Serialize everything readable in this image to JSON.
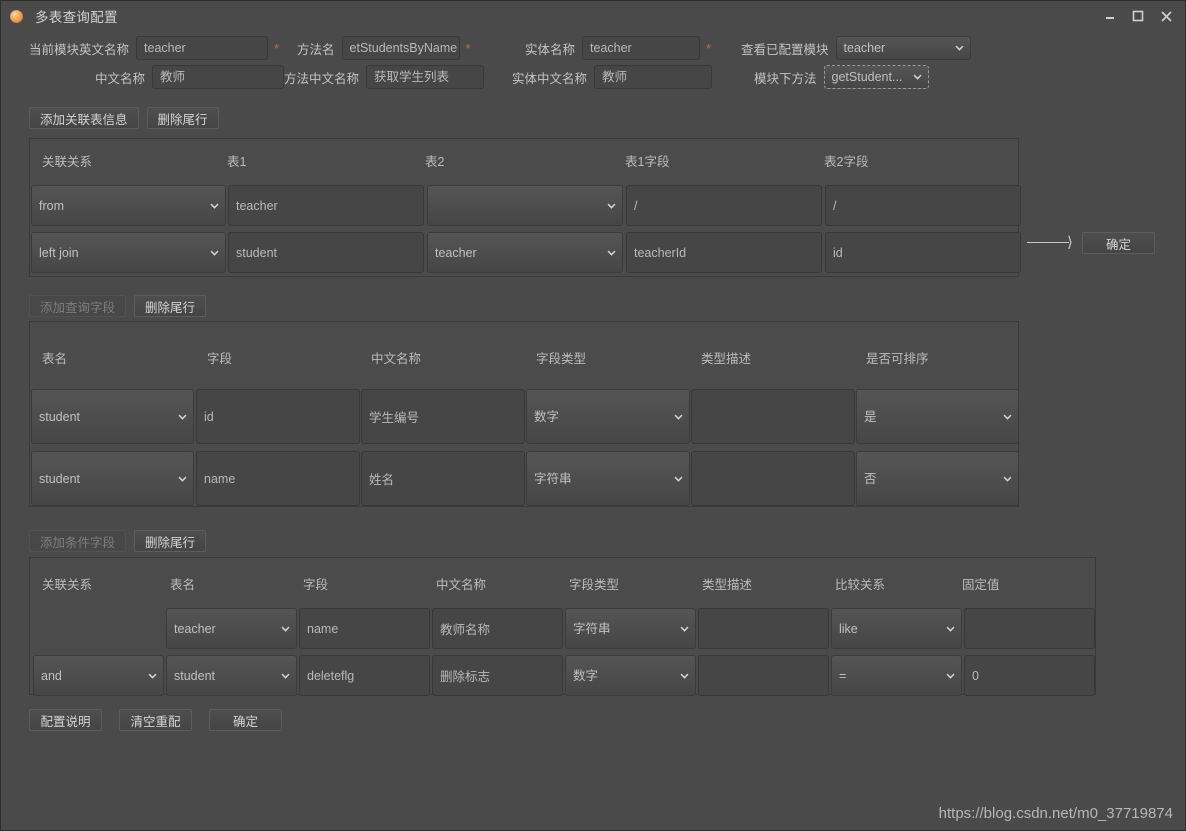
{
  "window": {
    "title": "多表查询配置",
    "icon": "app-palette-icon",
    "controls": {
      "minimize": "minimize-icon",
      "maximize": "maximize-icon",
      "close": "close-icon"
    }
  },
  "header": {
    "fields": [
      {
        "label": "当前模块英文名称",
        "value": "teacher",
        "type": "text",
        "required": true
      },
      {
        "label": "方法名",
        "value": "etStudentsByName",
        "type": "text",
        "required": true
      },
      {
        "label": "实体名称",
        "value": "teacher",
        "type": "text",
        "required": true
      },
      {
        "label": "查看已配置模块",
        "value": "teacher",
        "type": "select",
        "required": false
      },
      {
        "label": "中文名称",
        "value": "教师",
        "type": "text",
        "required": false
      },
      {
        "label": "方法中文名称",
        "value": "获取学生列表",
        "type": "text",
        "required": false
      },
      {
        "label": "实体中文名称",
        "value": "教师",
        "type": "text",
        "required": false
      },
      {
        "label": "模块下方法",
        "value": "getStudent...",
        "type": "select",
        "required": false
      }
    ]
  },
  "section_relation": {
    "buttons": [
      {
        "label": "添加关联表信息",
        "disabled": false
      },
      {
        "label": "删除尾行",
        "disabled": false
      }
    ],
    "columns": [
      "关联关系",
      "表1",
      "表2",
      "表1字段",
      "表2字段"
    ],
    "rows": [
      {
        "relation": {
          "value": "from",
          "type": "select"
        },
        "table1": {
          "value": "teacher",
          "type": "text"
        },
        "table2": {
          "value": "",
          "type": "select"
        },
        "field1": {
          "value": "/",
          "type": "text"
        },
        "field2": {
          "value": "/",
          "type": "text"
        }
      },
      {
        "relation": {
          "value": "left join",
          "type": "select"
        },
        "table1": {
          "value": "student",
          "type": "text"
        },
        "table2": {
          "value": "teacher",
          "type": "select"
        },
        "field1": {
          "value": "teacherId",
          "type": "text"
        },
        "field2": {
          "value": "id",
          "type": "text"
        }
      }
    ],
    "confirm_label": "确定",
    "arrow": "arrow-right-icon"
  },
  "section_query": {
    "buttons": [
      {
        "label": "添加查询字段",
        "disabled": true
      },
      {
        "label": "删除尾行",
        "disabled": false
      }
    ],
    "columns": [
      "表名",
      "字段",
      "中文名称",
      "字段类型",
      "类型描述",
      "是否可排序"
    ],
    "rows": [
      {
        "table": {
          "value": "student",
          "type": "select"
        },
        "field": {
          "value": "id",
          "type": "text"
        },
        "cn_name": {
          "value": "学生编号",
          "type": "text"
        },
        "field_type": {
          "value": "数字",
          "type": "select"
        },
        "type_desc": {
          "value": "",
          "type": "text"
        },
        "sortable": {
          "value": "是",
          "type": "select"
        }
      },
      {
        "table": {
          "value": "student",
          "type": "select"
        },
        "field": {
          "value": "name",
          "type": "text"
        },
        "cn_name": {
          "value": "姓名",
          "type": "text"
        },
        "field_type": {
          "value": "字符串",
          "type": "select"
        },
        "type_desc": {
          "value": "",
          "type": "text"
        },
        "sortable": {
          "value": "否",
          "type": "select"
        }
      }
    ]
  },
  "section_condition": {
    "buttons": [
      {
        "label": "添加条件字段",
        "disabled": true
      },
      {
        "label": "删除尾行",
        "disabled": false
      }
    ],
    "columns": [
      "关联关系",
      "表名",
      "字段",
      "中文名称",
      "字段类型",
      "类型描述",
      "比较关系",
      "固定值"
    ],
    "rows": [
      {
        "relation": {
          "value": "",
          "type": "none"
        },
        "table": {
          "value": "teacher",
          "type": "select"
        },
        "field": {
          "value": "name",
          "type": "text"
        },
        "cn_name": {
          "value": "教师名称",
          "type": "text"
        },
        "field_type": {
          "value": "字符串",
          "type": "select"
        },
        "type_desc": {
          "value": "",
          "type": "text"
        },
        "compare": {
          "value": "like",
          "type": "select"
        },
        "fixed_value": {
          "value": "",
          "type": "text"
        }
      },
      {
        "relation": {
          "value": "and",
          "type": "select"
        },
        "table": {
          "value": "student",
          "type": "select"
        },
        "field": {
          "value": "deleteflg",
          "type": "text"
        },
        "cn_name": {
          "value": "删除标志",
          "type": "text"
        },
        "field_type": {
          "value": "数字",
          "type": "select"
        },
        "type_desc": {
          "value": "",
          "type": "text"
        },
        "compare": {
          "value": "=",
          "type": "select"
        },
        "fixed_value": {
          "value": "0",
          "type": "text"
        }
      }
    ]
  },
  "footer": {
    "buttons": [
      {
        "label": "配置说明",
        "disabled": false
      },
      {
        "label": "清空重配",
        "disabled": false
      },
      {
        "label": "确定",
        "disabled": false
      }
    ]
  },
  "watermark": "https://blog.csdn.net/m0_37719874",
  "colors": {
    "window_bg": "#4a4a4a",
    "input_bg": "#464646",
    "panel_bg": "#4b4b4b",
    "text": "#c8c8c8",
    "required_asterisk": "#c0645f"
  }
}
